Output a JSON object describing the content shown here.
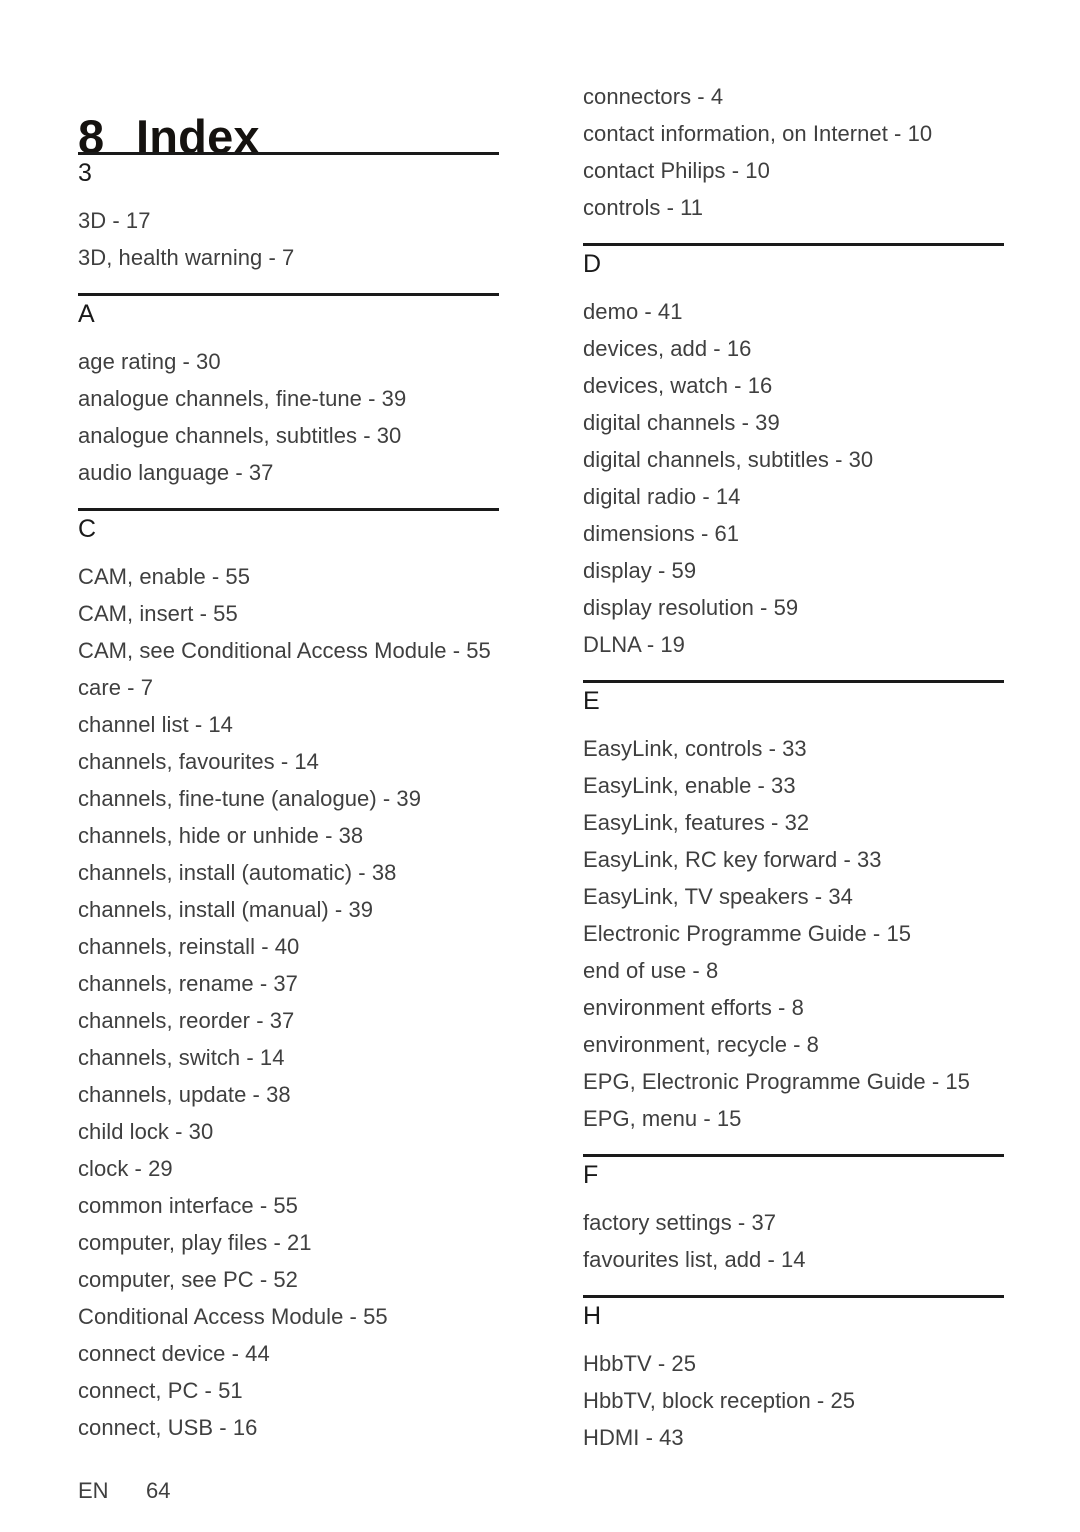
{
  "document": {
    "title_number": "8",
    "title_text": "Index"
  },
  "footer": {
    "language": "EN",
    "page_number": "64"
  },
  "left_column": {
    "sections": [
      {
        "letter": "3",
        "entries": [
          "3D - 17",
          "3D, health warning - 7"
        ]
      },
      {
        "letter": "A",
        "entries": [
          "age rating - 30",
          "analogue channels, fine-tune - 39",
          "analogue channels, subtitles - 30",
          "audio language - 37"
        ]
      },
      {
        "letter": "C",
        "entries": [
          "CAM, enable - 55",
          "CAM, insert - 55",
          "CAM, see Conditional Access Module - 55",
          "care - 7",
          "channel list - 14",
          "channels, favourites - 14",
          "channels, fine-tune (analogue) - 39",
          "channels, hide or unhide - 38",
          "channels, install (automatic) - 38",
          "channels, install (manual) - 39",
          "channels, reinstall - 40",
          "channels, rename - 37",
          "channels, reorder - 37",
          "channels, switch - 14",
          "channels, update - 38",
          "child lock - 30",
          "clock - 29",
          "common interface - 55",
          "computer, play files - 21",
          "computer, see PC - 52",
          "Conditional Access Module - 55",
          "connect device - 44",
          "connect, PC - 51",
          "connect, USB - 16"
        ]
      }
    ]
  },
  "right_column": {
    "continued_entries": [
      "connectors - 4",
      "contact information, on Internet - 10",
      "contact Philips - 10",
      "controls - 11"
    ],
    "sections": [
      {
        "letter": "D",
        "entries": [
          "demo - 41",
          "devices, add - 16",
          "devices, watch - 16",
          "digital channels - 39",
          "digital channels, subtitles - 30",
          "digital radio - 14",
          "dimensions - 61",
          "display - 59",
          "display resolution - 59",
          "DLNA - 19"
        ]
      },
      {
        "letter": "E",
        "entries": [
          "EasyLink, controls - 33",
          "EasyLink, enable - 33",
          "EasyLink, features - 32",
          "EasyLink, RC key forward - 33",
          "EasyLink, TV speakers - 34",
          "Electronic Programme Guide - 15",
          "end of use - 8",
          "environment efforts - 8",
          "environment, recycle - 8",
          "EPG, Electronic Programme Guide - 15",
          "EPG, menu - 15"
        ]
      },
      {
        "letter": "F",
        "entries": [
          "factory settings - 37",
          "favourites list, add - 14"
        ]
      },
      {
        "letter": "H",
        "entries": [
          "HbbTV - 25",
          "HbbTV, block reception - 25",
          "HDMI - 43"
        ]
      }
    ]
  }
}
